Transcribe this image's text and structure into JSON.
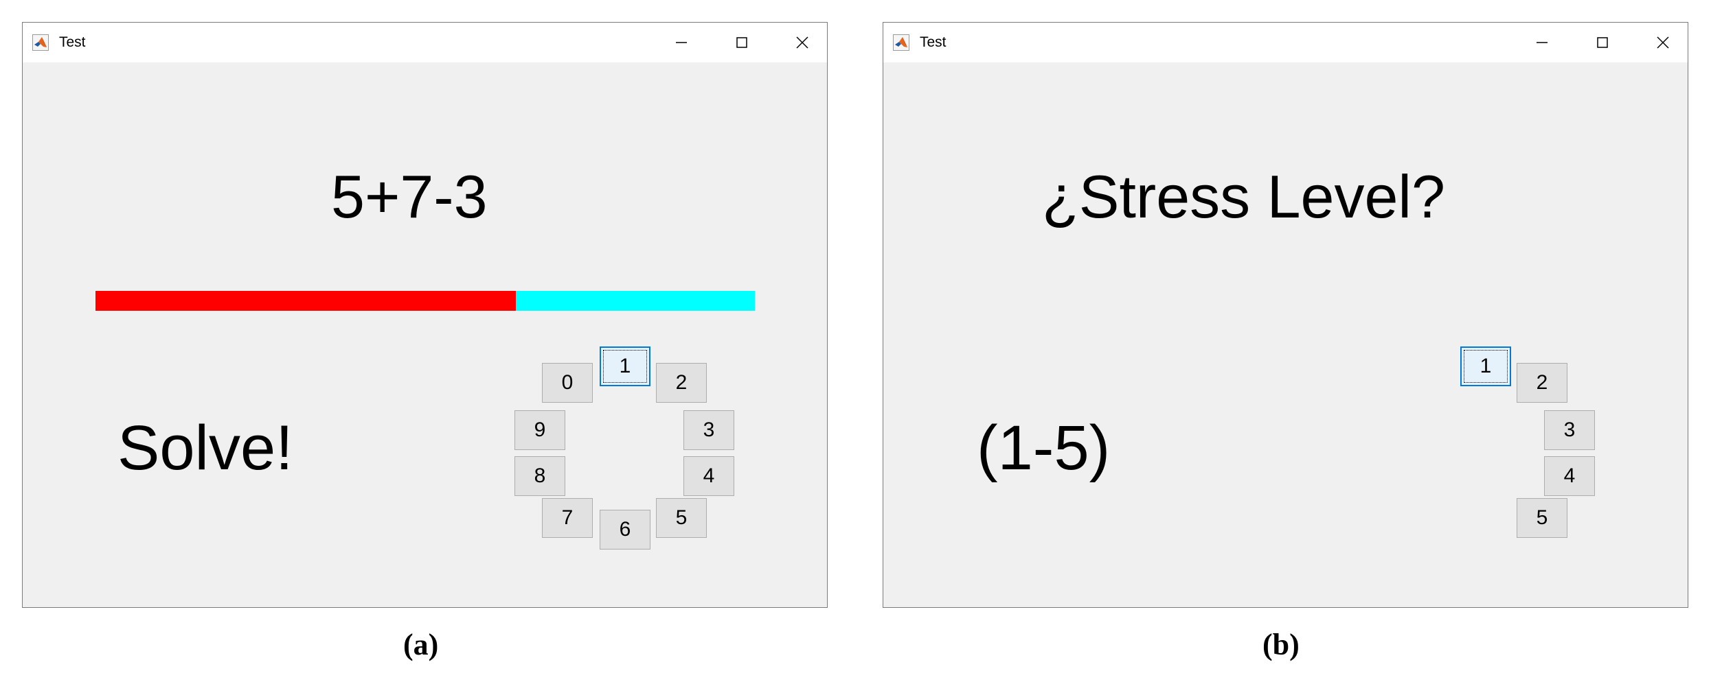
{
  "windows": [
    {
      "title": "Test",
      "heading": "5+7-3",
      "prompt": "Solve!",
      "progress": {
        "filled_fraction": 0.637,
        "filled_color": "#ff0000",
        "remaining_color": "#00ffff"
      },
      "keypad": [
        "0",
        "1",
        "2",
        "3",
        "4",
        "5",
        "6",
        "7",
        "8",
        "9"
      ],
      "focused_key": "1"
    },
    {
      "title": "Test",
      "heading": "¿Stress Level?",
      "prompt": "(1-5)",
      "keypad": [
        "1",
        "2",
        "3",
        "4",
        "5"
      ],
      "focused_key": "1"
    }
  ],
  "captions": [
    "(a)",
    "(b)"
  ],
  "icons": {
    "app": "matlab-icon",
    "minimize": "minimize-icon",
    "maximize": "maximize-icon",
    "close": "close-icon"
  }
}
